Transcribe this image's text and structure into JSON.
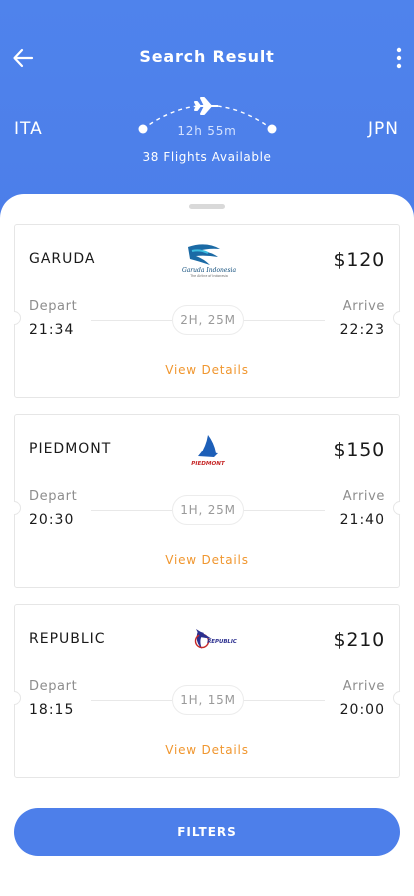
{
  "header": {
    "title": "Search Result",
    "origin": "ITA",
    "destination": "JPN",
    "duration": "12h 55m",
    "available": "38 Flights Available"
  },
  "labels": {
    "depart": "Depart",
    "arrive": "Arrive",
    "view_details": "View Details"
  },
  "flights": [
    {
      "airline": "GARUDA",
      "price": "$120",
      "depart": "21:34",
      "arrive": "22:23",
      "duration": "2H, 25M",
      "logo": "garuda-logo",
      "logo_text": "Garuda Indonesia",
      "logo_tagline": "The Airline of Indonesia"
    },
    {
      "airline": "PIEDMONT",
      "price": "$150",
      "depart": "20:30",
      "arrive": "21:40",
      "duration": "1H, 25M",
      "logo": "piedmont-logo",
      "logo_text": "PIEDMONT"
    },
    {
      "airline": "REPUBLIC",
      "price": "$210",
      "depart": "18:15",
      "arrive": "20:00",
      "duration": "1H, 15M",
      "logo": "republic-logo",
      "logo_text": "REPUBLIC"
    }
  ],
  "filters_button": "FILTERS",
  "icons": {
    "back": "arrow-left-icon",
    "more": "more-vertical-icon",
    "route": "airplane-icon"
  },
  "colors": {
    "primary": "#4d7fea",
    "accent": "#f0962e",
    "text": "#1a1a1a",
    "muted": "#8d8d8d"
  }
}
